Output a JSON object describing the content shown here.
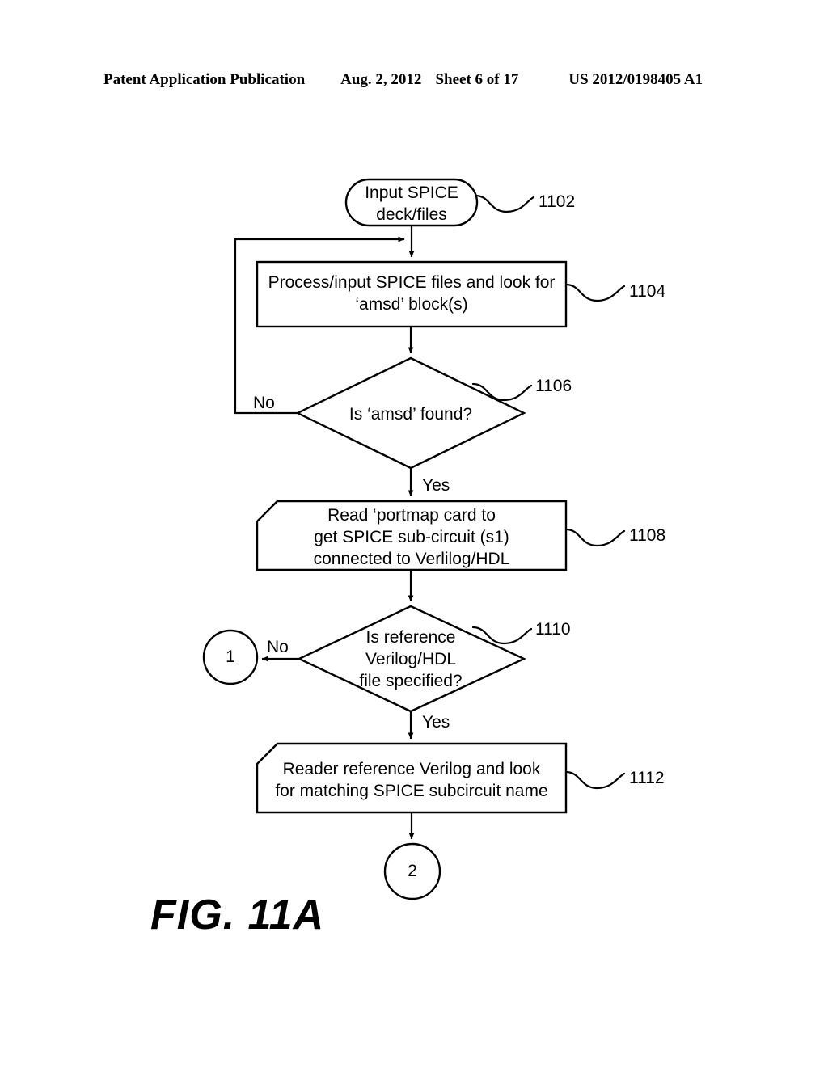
{
  "page_header": {
    "publication": "Patent Application Publication",
    "date": "Aug. 2, 2012",
    "sheet": "Sheet 6 of 17",
    "patent_number": "US 2012/0198405 A1"
  },
  "figure": {
    "caption": "FIG. 11A"
  },
  "flowchart": {
    "nodes": [
      {
        "id": "n1102",
        "shape": "stadium",
        "text": "Input SPICE\ndeck/files",
        "ref": "1102"
      },
      {
        "id": "n1104",
        "shape": "rectangle",
        "text": "Process/input SPICE files and look for\n‘amsd’ block(s)",
        "ref": "1104"
      },
      {
        "id": "n1106",
        "shape": "diamond",
        "text": "Is ‘amsd’ found?",
        "ref": "1106"
      },
      {
        "id": "n1108",
        "shape": "card",
        "text": "Read ‘portmap card to\nget SPICE sub-circuit (s1)\nconnected to Verlilog/HDL",
        "ref": "1108"
      },
      {
        "id": "n1110",
        "shape": "diamond",
        "text": "Is reference\nVerilog/HDL\nfile specified?",
        "ref": "1110"
      },
      {
        "id": "n1112",
        "shape": "card",
        "text": "Reader reference Verilog and look\nfor matching SPICE subcircuit name",
        "ref": "1112"
      }
    ],
    "connectors": [
      {
        "id": "c1",
        "label": "1"
      },
      {
        "id": "c2",
        "label": "2"
      }
    ],
    "edge_labels": {
      "no_1106": "No",
      "yes_1106": "Yes",
      "no_1110": "No",
      "yes_1110": "Yes"
    }
  },
  "colors": {
    "ink": "#000000",
    "paper": "#ffffff"
  }
}
